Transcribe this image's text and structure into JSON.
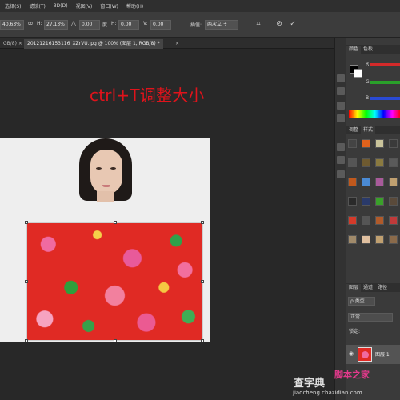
{
  "menu": [
    "选择(S)",
    "滤镜(T)",
    "3D(D)",
    "视图(V)",
    "窗口(W)",
    "帮助(H)"
  ],
  "options": {
    "w_value": "40.63%",
    "h_label": "H:",
    "h_value": "27.13%",
    "angle_value": "0.00",
    "hskew_label": "H:",
    "hskew_value": "0.00",
    "vskew_label": "V:",
    "vskew_value": "0.00",
    "interp_label": "插值:",
    "interp_value": "两次立 ÷",
    "cancel_icon": "⊘",
    "commit_icon": "✓"
  },
  "tabs": [
    {
      "label": "GB/8) ×",
      "active": false
    },
    {
      "label": "20121216153116_XZrVU.jpg @ 100% (图层 1, RGB/8) *",
      "active": true
    },
    {
      "label": "×",
      "active": false
    }
  ],
  "caption": "ctrl+T调整大小",
  "panels": {
    "color_tabs": [
      "颜色",
      "色板"
    ],
    "slider_labels": [
      "R",
      "G",
      "B"
    ],
    "style_tabs": [
      "调整",
      "样式"
    ],
    "layer_tabs": [
      "图层",
      "通道",
      "路径"
    ],
    "layer_kind": "ρ 类型",
    "blend_mode": "正常",
    "lock_label": "锁定:",
    "layer_name": "图层 1"
  },
  "colors": {
    "caption": "#e0131b",
    "slider_r": "#d42a2a",
    "slider_g": "#2aa02a",
    "slider_b": "#2a4ad4"
  },
  "watermark": {
    "site_cn": "查字典",
    "brand": "脚本之家",
    "url": "jiaocheng.chazidian.com"
  }
}
